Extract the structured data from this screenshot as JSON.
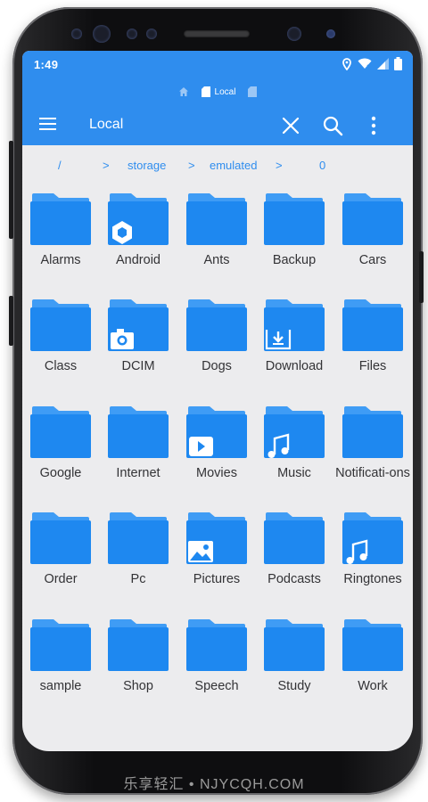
{
  "status_bar": {
    "time": "1:49"
  },
  "breadcrumb_top": {
    "active_label": "Local"
  },
  "toolbar": {
    "title": "Local"
  },
  "path": {
    "root": "/",
    "parts": [
      "storage",
      "emulated",
      "0"
    ]
  },
  "folders": [
    {
      "label": "Alarms",
      "badge": ""
    },
    {
      "label": "Android",
      "badge": "android"
    },
    {
      "label": "Ants",
      "badge": ""
    },
    {
      "label": "Backup",
      "badge": ""
    },
    {
      "label": "Cars",
      "badge": ""
    },
    {
      "label": "Class",
      "badge": ""
    },
    {
      "label": "DCIM",
      "badge": "camera"
    },
    {
      "label": "Dogs",
      "badge": ""
    },
    {
      "label": "Download",
      "badge": "download"
    },
    {
      "label": "Files",
      "badge": ""
    },
    {
      "label": "Google",
      "badge": ""
    },
    {
      "label": "Internet",
      "badge": ""
    },
    {
      "label": "Movies",
      "badge": "play"
    },
    {
      "label": "Music",
      "badge": "music"
    },
    {
      "label": "Notificati-ons",
      "badge": ""
    },
    {
      "label": "Order",
      "badge": ""
    },
    {
      "label": "Pc",
      "badge": ""
    },
    {
      "label": "Pictures",
      "badge": "picture"
    },
    {
      "label": "Podcasts",
      "badge": ""
    },
    {
      "label": "Ringtones",
      "badge": "music"
    },
    {
      "label": "sample",
      "badge": ""
    },
    {
      "label": "Shop",
      "badge": ""
    },
    {
      "label": "Speech",
      "badge": ""
    },
    {
      "label": "Study",
      "badge": ""
    },
    {
      "label": "Work",
      "badge": ""
    }
  ],
  "colors": {
    "accent": "#2f8dee",
    "folder": "#1e88f0",
    "folder_tab": "#3f9cf5",
    "screen_bg": "#ececee"
  },
  "watermark": "乐享轻汇 • NJYCQH.COM"
}
